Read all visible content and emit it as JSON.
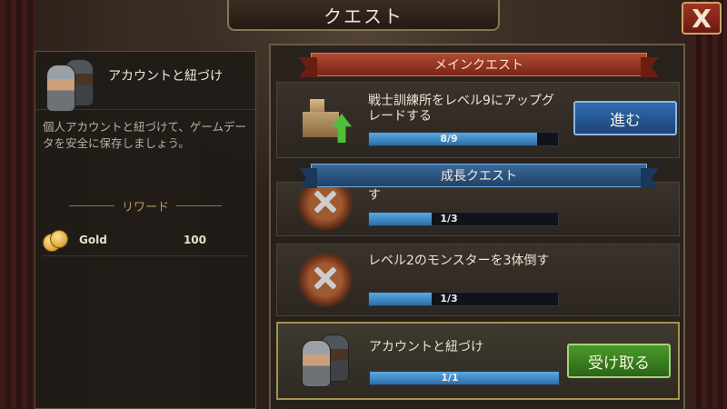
{
  "header": {
    "title": "クエスト"
  },
  "close_label": "X",
  "detail": {
    "title": "アカウントと紐づけ",
    "description": "個人アカウントと紐づけて、ゲームデータを安全に保存しましょう。",
    "reward_heading": "リワード",
    "reward": {
      "name": "Gold",
      "amount": "100"
    }
  },
  "main_quest": {
    "heading": "メインクエスト",
    "text": "戦士訓練所をレベル9にアップグレードする",
    "progress_label": "8/9",
    "progress": 0.89,
    "button_label": "進む"
  },
  "growth_quest": {
    "heading": "成長クエスト",
    "items": [
      {
        "text": "す",
        "progress_label": "1/3",
        "progress": 0.33
      },
      {
        "text": "レベル2のモンスターを3体倒す",
        "progress_label": "1/3",
        "progress": 0.33
      },
      {
        "text": "アカウントと紐づけ",
        "progress_label": "1/1",
        "progress": 1.0,
        "button_label": "受け取る"
      }
    ]
  }
}
